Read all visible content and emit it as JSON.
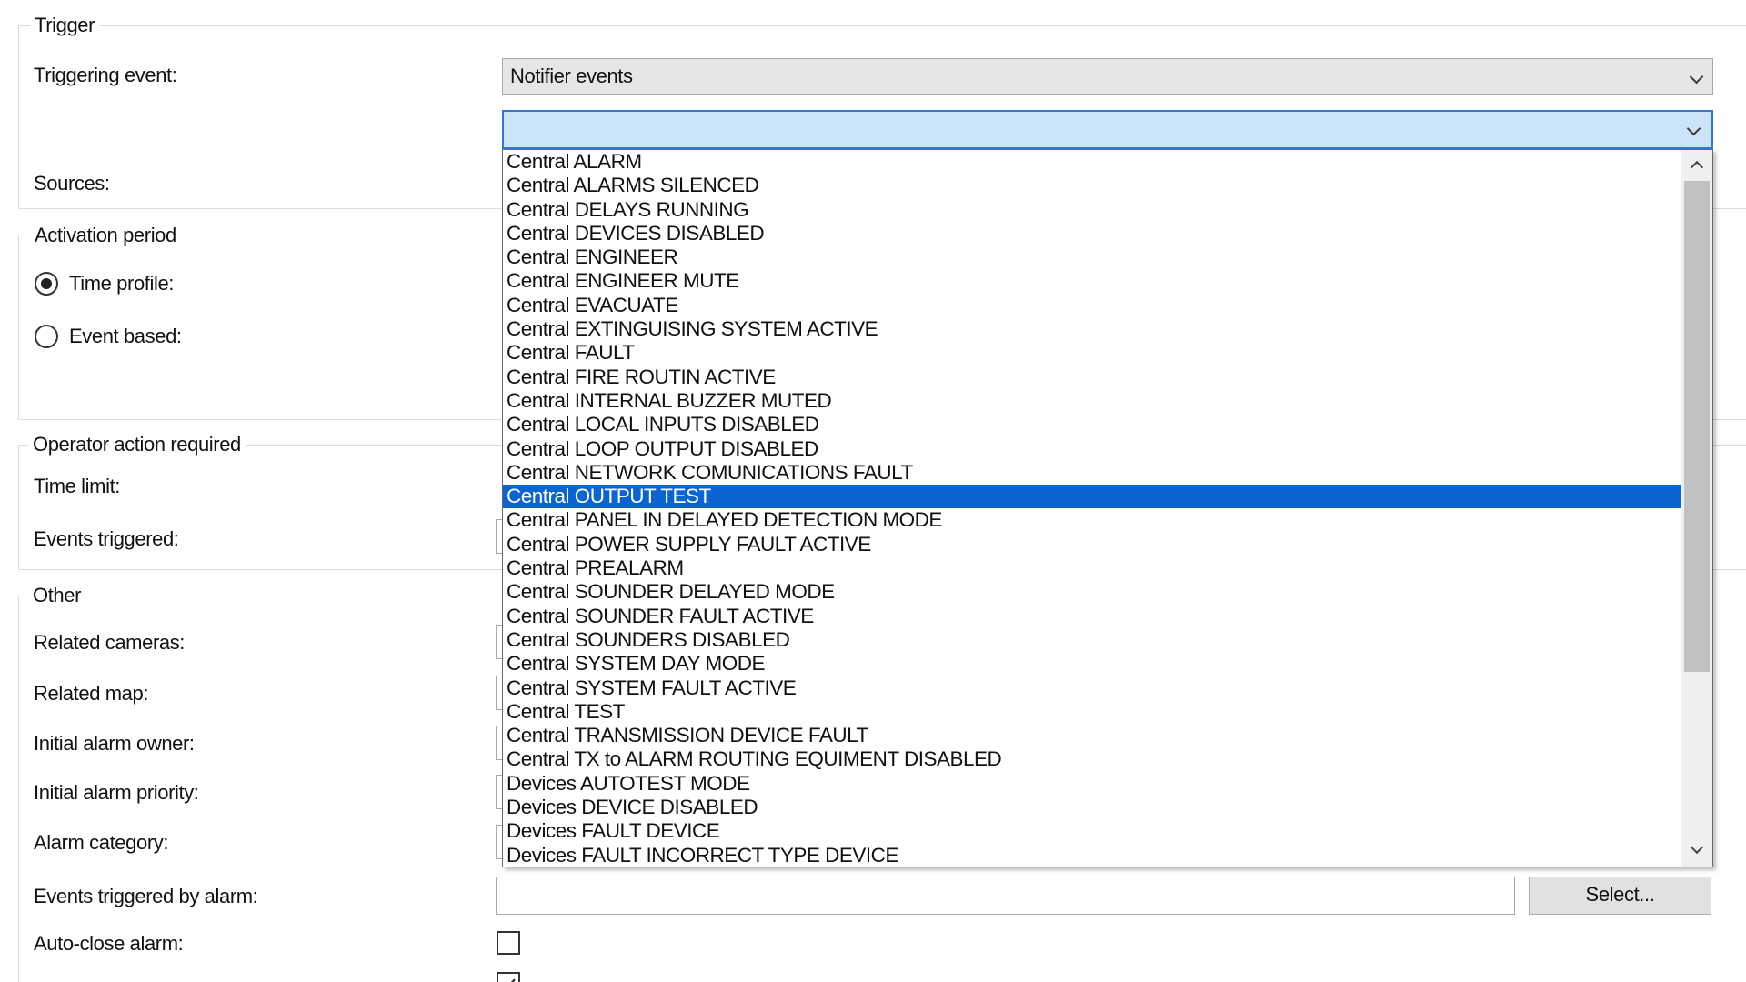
{
  "trigger": {
    "section_title": "Trigger",
    "triggering_event_label": "Triggering event:",
    "triggering_event_value": "Notifier events",
    "event_combo_value": "",
    "sources_label": "Sources:"
  },
  "activation": {
    "section_title": "Activation period",
    "time_profile_label": "Time profile:",
    "time_profile_selected": true,
    "event_based_label": "Event based:",
    "event_based_selected": false
  },
  "operator": {
    "section_title": "Operator action required",
    "time_limit_label": "Time limit:",
    "events_triggered_label": "Events triggered:"
  },
  "other": {
    "section_title": "Other",
    "related_cameras_label": "Related cameras:",
    "related_map_label": "Related map:",
    "initial_alarm_owner_label": "Initial alarm owner:",
    "initial_alarm_priority_label": "Initial alarm priority:",
    "alarm_category_label": "Alarm category:",
    "events_triggered_by_alarm_label": "Events triggered by alarm:",
    "events_triggered_by_alarm_value": "",
    "select_button_label": "Select...",
    "auto_close_alarm_label": "Auto-close alarm:",
    "auto_close_alarm_checked": false,
    "alarm_assignable_admin_checked": true
  },
  "dropdown": {
    "selected_index": 14,
    "items": [
      "Central ALARM",
      "Central ALARMS SILENCED",
      "Central DELAYS RUNNING",
      "Central DEVICES DISABLED",
      "Central ENGINEER",
      "Central ENGINEER MUTE",
      "Central EVACUATE",
      "Central EXTINGUISING SYSTEM ACTIVE",
      "Central FAULT",
      "Central FIRE ROUTIN ACTIVE",
      "Central INTERNAL BUZZER MUTED",
      "Central LOCAL INPUTS DISABLED",
      "Central LOOP OUTPUT DISABLED",
      "Central NETWORK COMUNICATIONS FAULT",
      "Central OUTPUT TEST",
      "Central PANEL IN DELAYED DETECTION MODE",
      "Central POWER SUPPLY FAULT ACTIVE",
      "Central PREALARM",
      "Central SOUNDER DELAYED MODE",
      "Central SOUNDER FAULT ACTIVE",
      "Central SOUNDERS DISABLED",
      "Central SYSTEM DAY MODE",
      "Central SYSTEM FAULT ACTIVE",
      "Central TEST",
      "Central TRANSMISSION DEVICE FAULT",
      "Central TX to ALARM ROUTING EQUIMENT DISABLED",
      "Devices AUTOTEST MODE",
      "Devices DEVICE DISABLED",
      "Devices FAULT DEVICE",
      "Devices FAULT INCORRECT TYPE DEVICE"
    ],
    "scroll_position": 0.0
  },
  "icons": {
    "combo_chevron": "chevron-down-icon",
    "scroll_up": "scroll-up-arrow-icon",
    "scroll_down": "scroll-down-arrow-icon",
    "checkmark": "checkmark-icon"
  },
  "colors": {
    "selection": "#0a64d2",
    "focus_border": "#2f7ad3",
    "focus_fill": "#cce4f7"
  }
}
